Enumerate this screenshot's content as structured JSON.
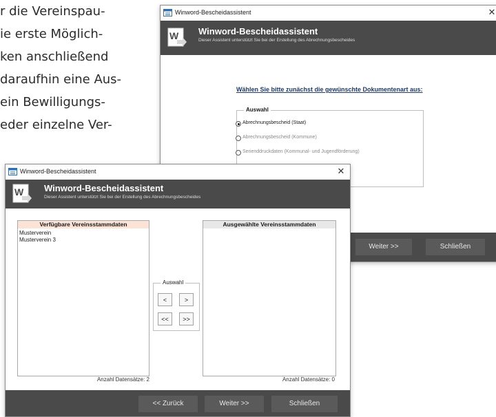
{
  "background_text": [
    "r die Vereinspau-",
    "ie erste Möglich-",
    "ken anschließend",
    "daraufhin eine Aus-",
    "ein Bewilligungs-",
    "eder einzelne Ver-"
  ],
  "back_window": {
    "title": "Winword-Bescheidassistent",
    "header_title": "Winword-Bescheidassistent",
    "header_subtitle": "Dieser Assistent unterstützt Sie bei der Erstellung des Abrechnungsbescheides",
    "prompt": "Wählen Sie bitte zunächst die gewünschte Dokumentenart aus:",
    "group_label": "Auswahl",
    "options": [
      {
        "label": "Abrechnungsbescheid (Staat)",
        "selected": true
      },
      {
        "label": "Abrechnungsbescheid (Kommune)",
        "selected": false
      },
      {
        "label": "Serienddruckdaten (Kommunal- und Jugendförderung)",
        "selected": false
      }
    ],
    "buttons": {
      "next": "Weiter >>",
      "close": "Schließen"
    }
  },
  "front_window": {
    "title": "Winword-Bescheidassistent",
    "header_title": "Winword-Bescheidassistent",
    "header_subtitle": "Dieser Assistent unterstützt Sie bei der Erstellung des Abrechnungsbescheides",
    "available": {
      "header": "Verfügbare Vereinsstammdaten",
      "items": [
        "Musterverein",
        "Musterverein 3"
      ],
      "count": "Anzahl Datensätze: 2"
    },
    "selected": {
      "header": "Ausgewählte Vereinsstammdaten",
      "items": [],
      "count": "Anzahl Datensätze: 0"
    },
    "selection": {
      "label": "Auswahl",
      "add_one": "<",
      "remove_one": ">",
      "add_all": "<<",
      "remove_all": ">>"
    },
    "buttons": {
      "back": "<< Zurück",
      "next": "Weiter >>",
      "close": "Schließen"
    }
  },
  "colors": {
    "header_bg": "#4a4a4a",
    "button_bg": "#5a5a5a",
    "available_header_bg": "#fbe3d6",
    "selected_header_bg": "#e8e8e8",
    "prompt_color": "#1f3a68"
  }
}
